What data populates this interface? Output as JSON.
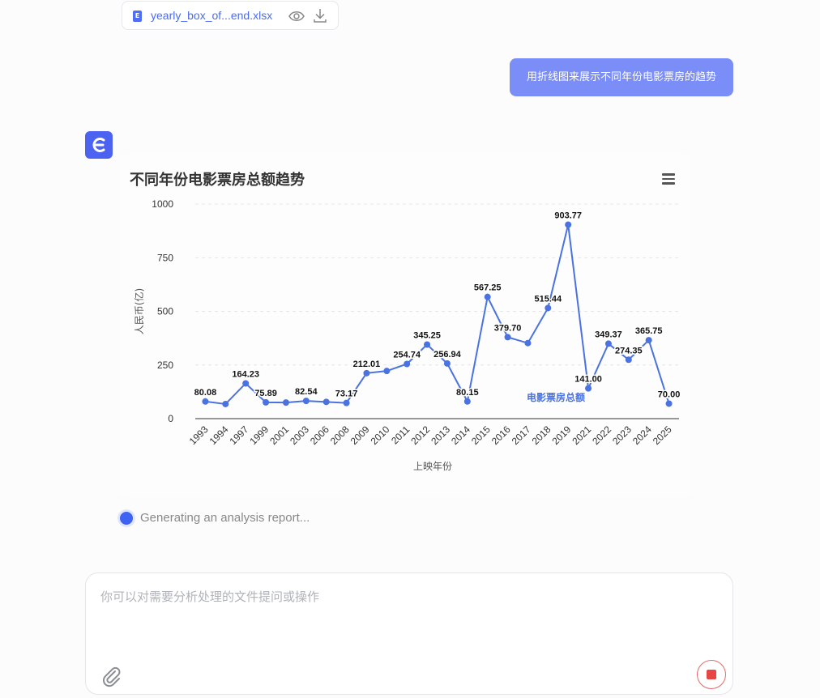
{
  "file": {
    "name": "yearly_box_of...end.xlsx",
    "type_badge": "E"
  },
  "user_message": "用折线图来展示不同年份电影票房的趋势",
  "status": {
    "text": "Generating an analysis report..."
  },
  "input": {
    "placeholder": "你可以对需要分析处理的文件提问或操作"
  },
  "colors": {
    "accent": "#4a6cf0",
    "line": "#4a72e0",
    "bubble": "#7b8ef7",
    "stop": "#e84545"
  },
  "chart_data": {
    "type": "line",
    "title": "不同年份电影票房总额趋势",
    "xlabel": "上映年份",
    "ylabel": "人民币(亿)",
    "ylim": [
      0,
      1000
    ],
    "yticks": [
      0,
      250,
      500,
      750,
      1000
    ],
    "grid": true,
    "categories": [
      "1993",
      "1994",
      "1997",
      "1999",
      "2001",
      "2003",
      "2006",
      "2008",
      "2009",
      "2010",
      "2011",
      "2012",
      "2013",
      "2014",
      "2015",
      "2016",
      "2017",
      "2018",
      "2019",
      "2021",
      "2022",
      "2023",
      "2024",
      "2025"
    ],
    "series": [
      {
        "name": "电影票房总额",
        "values": [
          80.08,
          68,
          164.23,
          75.89,
          75,
          82.54,
          78,
          73.17,
          212.01,
          222,
          254.74,
          345.25,
          256.94,
          80.15,
          567.25,
          379.7,
          352,
          515.44,
          903.77,
          141.0,
          349.37,
          274.35,
          365.75,
          70.0
        ],
        "labels": [
          "80.08",
          "",
          "164.23",
          "75.89",
          "",
          "82.54",
          "",
          "73.17",
          "212.01",
          "",
          "254.74",
          "345.25",
          "256.94",
          "80.15",
          "567.25",
          "379.70",
          "",
          "515.44",
          "903.77",
          "141.00",
          "349.37",
          "274.35",
          "365.75",
          "70.00"
        ]
      }
    ]
  }
}
